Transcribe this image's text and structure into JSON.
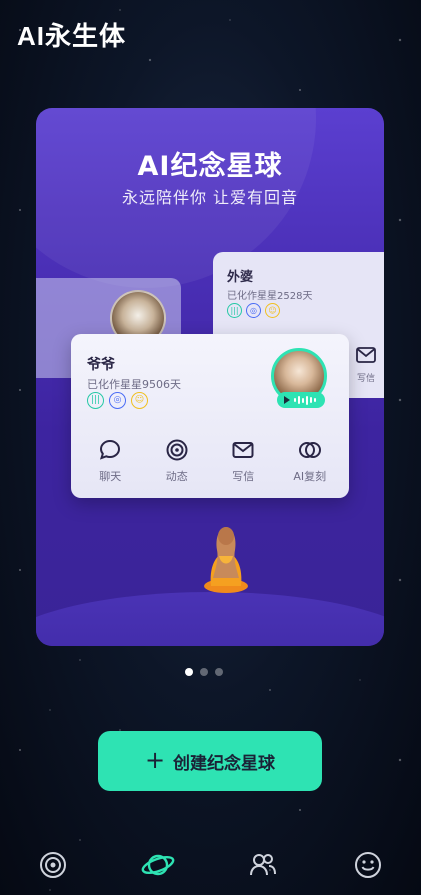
{
  "app": {
    "title": "AI永生体"
  },
  "card": {
    "title": "AI纪念星球",
    "subtitle": "永远陪伴你  让爱有回音"
  },
  "profiles": [
    {
      "name": "外婆",
      "days": "已化作星星2528天",
      "write_label": "写信"
    },
    {
      "name": "爷爷",
      "days": "已化作星星9506天"
    }
  ],
  "actions": [
    {
      "label": "聊天",
      "icon": "chat-bubble-icon"
    },
    {
      "label": "动态",
      "icon": "spiral-icon"
    },
    {
      "label": "写信",
      "icon": "envelope-icon"
    },
    {
      "label": "AI复刻",
      "icon": "overlap-circles-icon"
    }
  ],
  "pagination": {
    "total": 3,
    "active": 1
  },
  "create_button": {
    "label": "创建纪念星球",
    "icon": "plus-icon"
  },
  "bottom_nav": [
    {
      "icon": "spiral-icon",
      "active": false
    },
    {
      "icon": "planet-icon",
      "active": true
    },
    {
      "icon": "people-icon",
      "active": false
    },
    {
      "icon": "smile-icon",
      "active": false
    }
  ],
  "colors": {
    "accent": "#2ee3b3",
    "card_purple": "#4a2fb6",
    "voice_chip": "#26c9a6",
    "ring_chip": "#4a6cf5",
    "smile_chip": "#f0c020"
  }
}
